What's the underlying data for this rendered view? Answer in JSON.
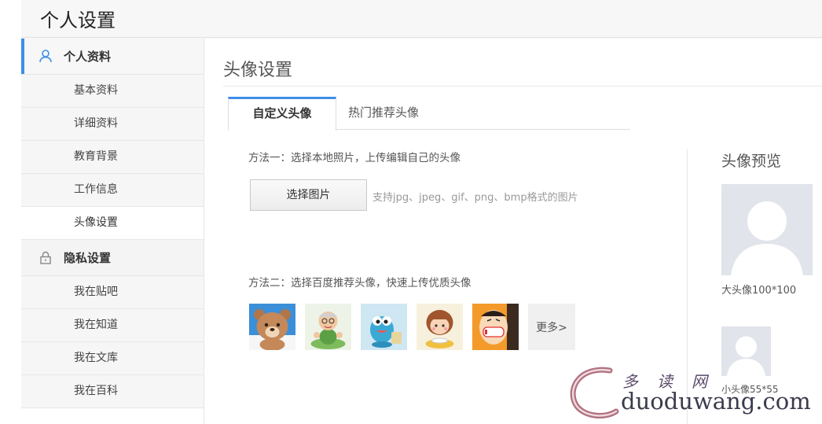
{
  "header": {
    "title": "个人设置"
  },
  "sidebar": {
    "sections": [
      {
        "label": "个人资料",
        "icon": "user-icon",
        "items": [
          "基本资料",
          "详细资料",
          "教育背景",
          "工作信息",
          "头像设置"
        ]
      },
      {
        "label": "隐私设置",
        "icon": "lock-icon",
        "items": [
          "我在贴吧",
          "我在知道",
          "我在文库",
          "我在百科"
        ]
      }
    ],
    "selected_item": "头像设置"
  },
  "main": {
    "title": "头像设置",
    "tabs": [
      {
        "label": "自定义头像",
        "active": true
      },
      {
        "label": "热门推荐头像",
        "active": false
      }
    ],
    "method1": {
      "text": "方法一：选择本地照片，上传编辑自己的头像",
      "button_label": "选择图片",
      "hint": "支持jpg、jpeg、gif、png、bmp格式的图片"
    },
    "method2": {
      "text": "方法二：选择百度推荐头像，快速上传优质头像",
      "avatars": [
        "bear-avatar",
        "old-man-avatar",
        "blue-fish-avatar",
        "girl-avatar",
        "smiling-man-avatar"
      ],
      "more_label": "更多>"
    },
    "preview": {
      "title": "头像预览",
      "big_label": "大头像100*100",
      "small_label": "小头像55*55"
    }
  },
  "watermark": {
    "cn": "多读网",
    "en": "duoduwang.com"
  },
  "colors": {
    "accent": "#3d8fe8",
    "sidebar_bg": "#f6f6f6",
    "placeholder_avatar": "#e1e4ea"
  }
}
